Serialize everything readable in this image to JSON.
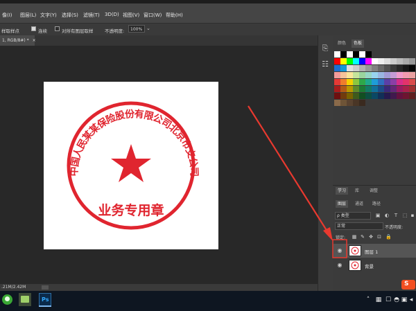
{
  "menubar": {
    "items": [
      "像(I)",
      "图层(L)",
      "文字(Y)",
      "选择(S)",
      "滤镜(T)",
      "3D(D)",
      "视图(V)",
      "窗口(W)",
      "帮助(H)"
    ]
  },
  "options": {
    "sample_label": "样取样点",
    "contiguous_label": "连续",
    "all_layers_label": "对所有图层取样",
    "opacity_label": "不透明度:",
    "opacity_value": "100%"
  },
  "document": {
    "tab_label": "1, RGB/8#) *",
    "close": "×",
    "status_text": ".21M/2.42M"
  },
  "seal": {
    "ring_text": "中国人民某某保险股份有限公司北京市支公司",
    "center_text": "业务专用章",
    "color": "#e0252f"
  },
  "panel": {
    "tabs": [
      "颜色",
      "色板"
    ],
    "swatches": [
      [
        "#ffffff",
        "#000000",
        "#ffffff",
        "#000000",
        "#ffffff",
        "#000000"
      ],
      [
        "#ff0000",
        "#ffff00",
        "#00ff00",
        "#00ffff",
        "#0000ff",
        "#ff00ff",
        "#ffffff",
        "#eeeeee",
        "#dddddd",
        "#cccccc",
        "#bbbbbb",
        "#aaaaaa",
        "#999999"
      ],
      [
        "#1e6fd0",
        "#1598d4",
        "#e0e0e0",
        "#cccccc",
        "#b0b0b0",
        "#989898",
        "#808080",
        "#686868",
        "#505050",
        "#3a3a3a",
        "#282828",
        "#181818",
        "#080808"
      ],
      [
        "#f29b9b",
        "#f6c39a",
        "#fbe59a",
        "#c6e39a",
        "#9ad49e",
        "#97d6c6",
        "#98d3ef",
        "#9ab6e2",
        "#a39bd6",
        "#c59bd5",
        "#f09bcb",
        "#f19bb0",
        "#e9a0a0"
      ],
      [
        "#e53935",
        "#ef7d2c",
        "#f6d000",
        "#8cc63f",
        "#2ea84a",
        "#1fa98c",
        "#1e9dd8",
        "#2f6fc0",
        "#5b3fa6",
        "#8b3fa6",
        "#d62d8a",
        "#e2336b",
        "#d94b4b"
      ],
      [
        "#a91c1c",
        "#b25a16",
        "#b99700",
        "#5f8b2a",
        "#1d7a35",
        "#137a66",
        "#11709a",
        "#1b4c87",
        "#3b2878",
        "#642778",
        "#991b62",
        "#a8214b",
        "#9e3030"
      ],
      [
        "#6e0f0f",
        "#713b0d",
        "#796200",
        "#3e5b1c",
        "#124f22",
        "#0c4f42",
        "#0a4864",
        "#112f57",
        "#26194e",
        "#41194e",
        "#64113f",
        "#6d1530",
        "#5e2020"
      ],
      [
        "#8a6a4a",
        "#6e5437",
        "#5a4330",
        "#4a3626",
        "#3a2a1f"
      ]
    ]
  },
  "stripicons": [
    "adjust-icon",
    "sliders-icon"
  ],
  "layers": {
    "top_tabs": [
      "学习",
      "库",
      "调整"
    ],
    "sub_tabs": [
      "图层",
      "通道",
      "路径"
    ],
    "filter_label": "ρ 类型",
    "blend_mode": "正常",
    "opacity_label": "不透明度:",
    "lock_label": "锁定:",
    "list": [
      {
        "name": "图层 1",
        "selected": true
      },
      {
        "name": "背景",
        "selected": false
      }
    ]
  },
  "taskbar": {
    "apps": [
      "start",
      "files",
      "photoshop"
    ],
    "ps_label": "Ps",
    "tray_icons": [
      "chevron-up-icon",
      "network-icon",
      "notification-icon",
      "chat-icon",
      "camera-icon",
      "speaker-icon",
      "ime-icon"
    ]
  },
  "colors": {
    "seal_red": "#e0252f",
    "accent_red": "#e8392f",
    "panel_bg": "#3b3b3b",
    "menubar_bg": "#454545"
  }
}
